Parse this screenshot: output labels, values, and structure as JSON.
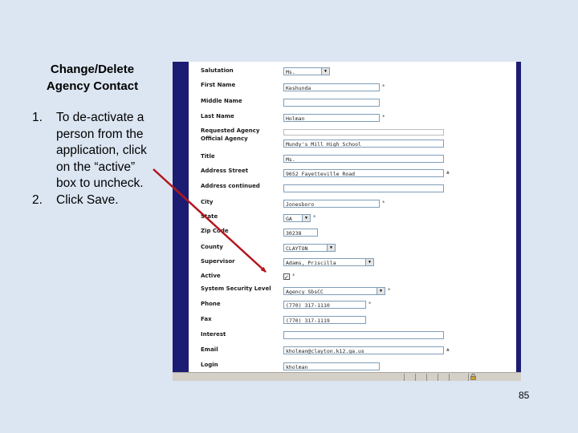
{
  "slide": {
    "title_line1": "Change/Delete",
    "title_line2": "Agency Contact",
    "steps": [
      {
        "number": "1.",
        "lines": [
          "To de-activate a",
          "person from the",
          "application, click",
          "on the “active”",
          "box to uncheck."
        ]
      },
      {
        "number": "2.",
        "lines": [
          "Click Save."
        ]
      }
    ],
    "page_number": "85"
  },
  "form": {
    "labels": {
      "salutation": "Salutation",
      "first_name": "First Name",
      "middle_name": "Middle Name",
      "last_name": "Last Name",
      "requested_agency": "Requested Agency",
      "official_agency": "Official Agency",
      "title": "Title",
      "address_street": "Address Street",
      "address_continued": "Address continued",
      "city": "City",
      "state": "State",
      "zip_code": "Zip Code",
      "county": "County",
      "supervisor": "Supervisor",
      "active": "Active",
      "system_security_level": "System Security Level",
      "phone": "Phone",
      "fax": "Fax",
      "interest": "Interest",
      "email": "Email",
      "login": "Login"
    },
    "values": {
      "salutation": "Ms.",
      "first_name": "Keshunda",
      "middle_name": "",
      "last_name": "Holman",
      "official_agency": "Mundy's Mill High School",
      "title": "Ms.",
      "address_street": "9652 Fayetteville Road",
      "address_continued": "",
      "city": "Jonesboro",
      "state": "GA",
      "zip_code": "30238",
      "county": "CLAYTON",
      "supervisor": "Adams, Priscilla",
      "active_check": "✓",
      "system_security_level": "Agency SbsCC",
      "phone": "(770) 317-1110",
      "fax": "(770) 317-1119",
      "interest": "",
      "email": "kholman@clayton.k12.ga.us",
      "login": "kholman"
    },
    "required_marker": "*",
    "scroll_marker": "▲",
    "dropdown_arrow": "▼"
  },
  "icons": {
    "lock": "lock-icon",
    "checkbox": "checkbox-icon",
    "arrow": "red-pointer-arrow"
  },
  "colors": {
    "slide_background": "#dce6f2",
    "frame": "#1c1c72",
    "arrow": "#b4151d",
    "field_border": "#7f9db9"
  }
}
